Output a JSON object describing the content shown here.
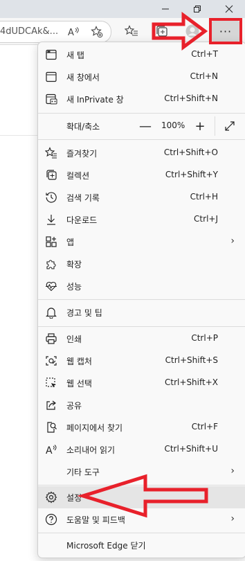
{
  "address_bar": {
    "url_fragment": "4dUDCAk&..."
  },
  "toolbar": {
    "read_aloud_label": "A",
    "more_label": "···"
  },
  "menu": {
    "new_tab": {
      "label": "새 탭",
      "shortcut": "Ctrl+T"
    },
    "new_window": {
      "label": "새 창에서",
      "shortcut": "Ctrl+N"
    },
    "inprivate": {
      "label": "새 InPrivate 창",
      "shortcut": "Ctrl+Shift+N"
    },
    "zoom": {
      "label": "확대/축소",
      "minus": "—",
      "value": "100%",
      "plus": "+"
    },
    "favorites": {
      "label": "즐겨찾기",
      "shortcut": "Ctrl+Shift+O"
    },
    "collections": {
      "label": "컬렉션",
      "shortcut": "Ctrl+Shift+Y"
    },
    "history": {
      "label": "검색 기록",
      "shortcut": "Ctrl+H"
    },
    "downloads": {
      "label": "다운로드",
      "shortcut": "Ctrl+J"
    },
    "apps": {
      "label": "앱",
      "chevron": "›"
    },
    "extensions": {
      "label": "확장"
    },
    "performance": {
      "label": "성능"
    },
    "alerts": {
      "label": "경고 및 팁"
    },
    "print": {
      "label": "인쇄",
      "shortcut": "Ctrl+P"
    },
    "web_capture": {
      "label": "웹 캡처",
      "shortcut": "Ctrl+Shift+S"
    },
    "web_select": {
      "label": "웹 선택",
      "shortcut": "Ctrl+Shift+X"
    },
    "share": {
      "label": "공유"
    },
    "find": {
      "label": "페이지에서 찾기",
      "shortcut": "Ctrl+F"
    },
    "read_aloud": {
      "label": "소리내어 읽기",
      "shortcut": "Ctrl+Shift+U"
    },
    "more_tools": {
      "label": "기타 도구",
      "chevron": "›"
    },
    "settings": {
      "label": "설정"
    },
    "help": {
      "label": "도움말 및 피드백",
      "chevron": "›"
    },
    "close": {
      "label": "Microsoft Edge 닫기"
    }
  },
  "colors": {
    "accent_arrow": "#e8212b",
    "menu_bg": "#f9f9f9",
    "highlight": "#e5e5e5"
  }
}
